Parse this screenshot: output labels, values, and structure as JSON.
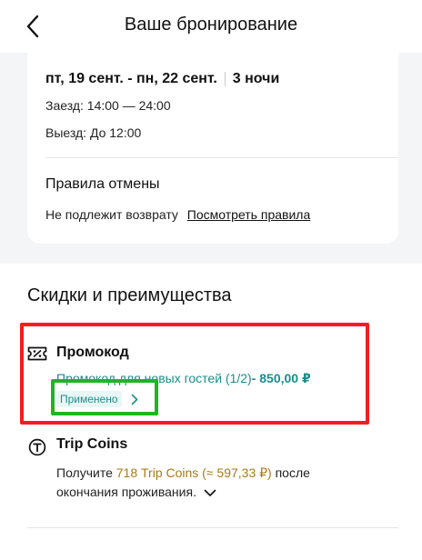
{
  "header": {
    "title": "Ваше бронирование",
    "back_icon": "chevron-left-icon"
  },
  "stay": {
    "dates": "пт, 19 сент. - пн, 22 сент.",
    "nights": "3 ночи",
    "checkin": "Заезд: 14:00 — 24:00",
    "checkout": "Выезд: До 12:00"
  },
  "cancellation": {
    "title": "Правила отмены",
    "policy": "Не подлежит возврату",
    "link": "Посмотреть правила"
  },
  "discounts": {
    "title": "Скидки и преимущества",
    "promo": {
      "icon": "percent-ticket-icon",
      "title": "Промокод",
      "description": "Промокод для новых гостей (1/2)",
      "amount": "- 850,00 ₽",
      "status": "Применено"
    },
    "trip_coins": {
      "icon": "trip-coin-icon",
      "title": "Trip Coins",
      "text_before": "Получите ",
      "coins_amount": "718 Trip Coins (≈ 597,33 ₽)",
      "text_after": " после окончания проживания."
    }
  },
  "colors": {
    "accent_teal": "#1a8f8a",
    "coins_gold": "#a97b14",
    "highlight_red": "#f21f1f",
    "highlight_green": "#20b424"
  }
}
